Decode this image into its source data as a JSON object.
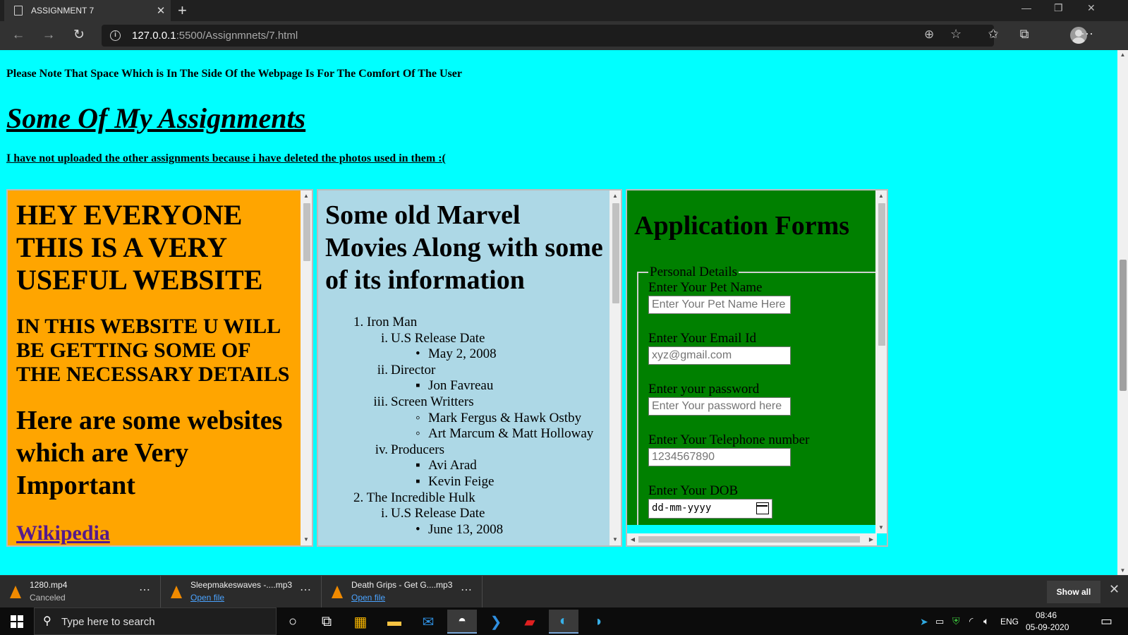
{
  "browser": {
    "tab_title": "ASSIGNMENT 7",
    "url_host": "127.0.0.1",
    "url_path": ":5500/Assignmnets/7.html"
  },
  "page": {
    "note": "Please Note That Space Which is In The Side Of the Webpage Is For The Comfort Of The User",
    "title": "Some Of My Assignments",
    "subnote": "I have not uploaded the other assignments because i have deleted the photos used in them :("
  },
  "frame1": {
    "heading1": "HEY EVERYONE THIS IS A VERY USEFUL WEBSITE",
    "heading2": "IN THIS WEBSITE U WILL BE GETTING SOME OF THE NECESSARY DETAILS",
    "heading3": "Here are some websites which are Very Important",
    "link": "Wikipedia"
  },
  "frame2": {
    "heading": "Some old Marvel Movies Along with some of its information",
    "movies": [
      {
        "num": "1.",
        "title": "Iron Man",
        "sections": [
          {
            "num": "i.",
            "label": "U.S Release Date",
            "bullet": "disc",
            "items": [
              "May 2, 2008"
            ]
          },
          {
            "num": "ii.",
            "label": "Director",
            "bullet": "square",
            "items": [
              "Jon Favreau"
            ]
          },
          {
            "num": "iii.",
            "label": "Screen Writters",
            "bullet": "circle",
            "items": [
              "Mark Fergus & Hawk Ostby",
              "Art Marcum & Matt Holloway"
            ]
          },
          {
            "num": "iv.",
            "label": "Producers",
            "bullet": "square",
            "items": [
              "Avi Arad",
              "Kevin Feige"
            ]
          }
        ]
      },
      {
        "num": "2.",
        "title": "The Incredible Hulk",
        "sections": [
          {
            "num": "i.",
            "label": "U.S Release Date",
            "bullet": "disc",
            "items": [
              "June 13, 2008"
            ]
          }
        ]
      }
    ]
  },
  "frame3": {
    "heading": "Application Forms",
    "legend": "Personal Details",
    "fields": {
      "pet_label": "Enter Your Pet Name",
      "pet_placeholder": "Enter Your Pet Name Here",
      "email_label": "Enter Your Email Id",
      "email_placeholder": "xyz@gmail.com",
      "password_label": "Enter your password",
      "password_placeholder": "Enter Your password here",
      "phone_label": "Enter Your Telephone number",
      "phone_placeholder": "1234567890",
      "dob_label": "Enter Your DOB",
      "dob_value": "dd-mm-yyyy"
    }
  },
  "downloads": [
    {
      "name": "1280.mp4",
      "status": "Canceled",
      "link": ""
    },
    {
      "name": "Sleepmakeswaves -....mp3",
      "status": "",
      "link": "Open file"
    },
    {
      "name": "Death Grips - Get G....mp3",
      "status": "",
      "link": "Open file"
    }
  ],
  "downloads_show_all": "Show all",
  "taskbar": {
    "search_placeholder": "Type here to search",
    "lang": "ENG",
    "time": "08:46",
    "date": "05-09-2020"
  }
}
